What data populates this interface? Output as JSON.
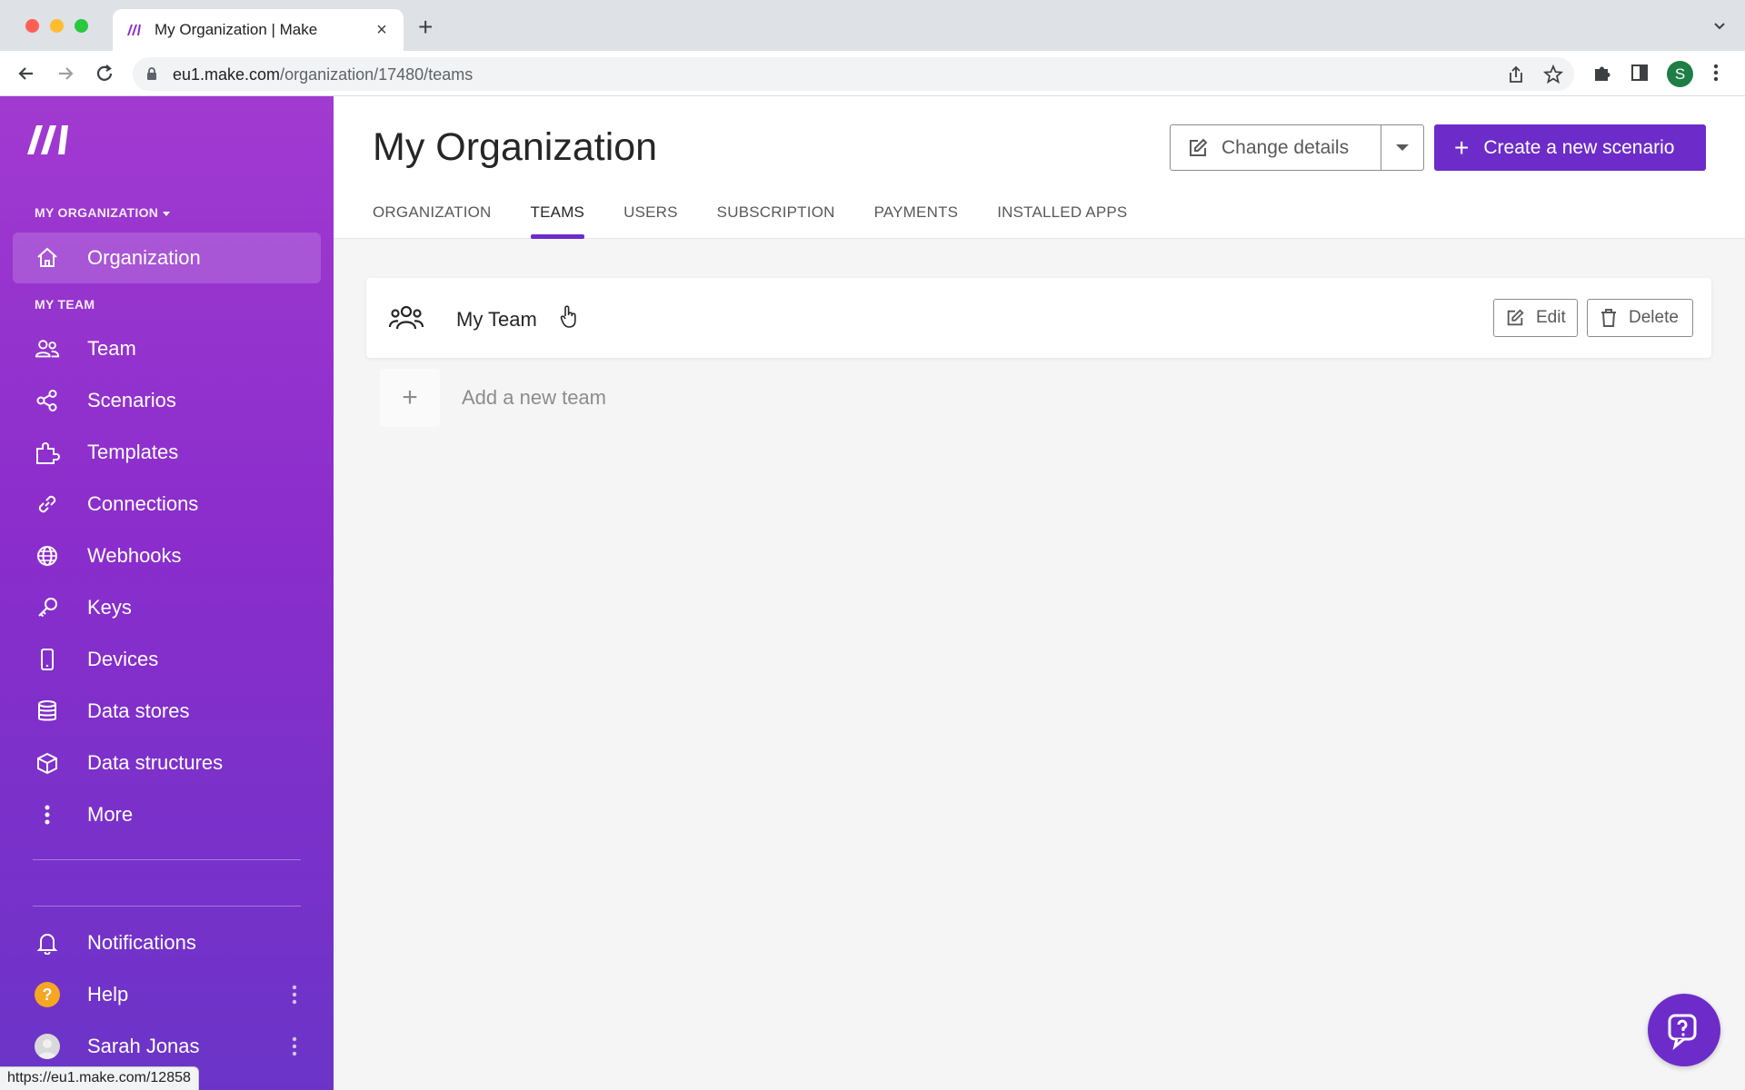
{
  "browser": {
    "tab_title": "My Organization | Make",
    "url_host": "eu1.make.com",
    "url_path": "/organization/17480/teams",
    "profile_initial": "S",
    "status_url": "https://eu1.make.com/12858"
  },
  "sidebar": {
    "org_switch": "MY ORGANIZATION",
    "organization_item": {
      "label": "Organization",
      "icon": "home-icon"
    },
    "team_section": "MY TEAM",
    "items": [
      {
        "label": "Team",
        "icon": "users-icon"
      },
      {
        "label": "Scenarios",
        "icon": "share-icon"
      },
      {
        "label": "Templates",
        "icon": "puzzle-icon"
      },
      {
        "label": "Connections",
        "icon": "link-icon"
      },
      {
        "label": "Webhooks",
        "icon": "globe-icon"
      },
      {
        "label": "Keys",
        "icon": "key-icon"
      },
      {
        "label": "Devices",
        "icon": "mobile-icon"
      },
      {
        "label": "Data stores",
        "icon": "database-icon"
      },
      {
        "label": "Data structures",
        "icon": "cube-icon"
      },
      {
        "label": "More",
        "icon": "more-vertical-icon"
      }
    ],
    "bottom": {
      "notifications": "Notifications",
      "help": "Help",
      "user": "Sarah Jonas"
    }
  },
  "header": {
    "title": "My Organization",
    "change_details": "Change details",
    "create_scenario": "Create a new scenario",
    "tabs": [
      "ORGANIZATION",
      "TEAMS",
      "USERS",
      "SUBSCRIPTION",
      "PAYMENTS",
      "INSTALLED APPS"
    ],
    "active_tab": "TEAMS"
  },
  "teams": {
    "list": [
      {
        "name": "My Team"
      }
    ],
    "edit_label": "Edit",
    "delete_label": "Delete",
    "add_label": "Add a new team"
  },
  "colors": {
    "accent": "#6d2cc9",
    "sidebar_top": "#a13ad0",
    "sidebar_bottom": "#6b34c8"
  }
}
